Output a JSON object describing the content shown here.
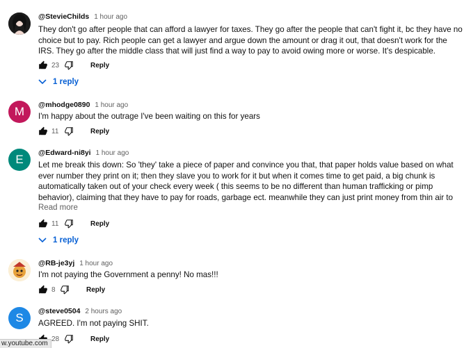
{
  "comments": [
    {
      "author": "@StevieChilds",
      "time": "1 hour ago",
      "text": "They don't go after people that can afford a lawyer for taxes. They go after the people that can't fight it, bc they have no choice but to pay. Rich people can get a lawyer and argue down the amount or drag it out, that doesn't work for the IRS. They go after the middle class that will just find a way to pay to avoid owing more or worse. It's despicable.",
      "likes": "23",
      "reply_label": "Reply",
      "replies_label": "1 reply",
      "avatar_color": "#2a2a2a"
    },
    {
      "author": "@mhodge0890",
      "time": "1 hour ago",
      "text": "I'm happy about the outrage I've been waiting on this for years",
      "likes": "11",
      "reply_label": "Reply",
      "avatar_letter": "M",
      "avatar_color": "#c2185b"
    },
    {
      "author": "@Edward-ni8yi",
      "time": "1 hour ago",
      "text": "Let me break this down: So 'they' take a piece of paper and convince you that, that paper holds value based on what ever number they print on it; then they slave you to work for it but when it comes time to get paid, a big chunk is automatically taken out of your check every week ( this seems to be no different than human trafficking or pimp behavior), claiming that they have to pay for roads, garbage ect. meanwhile they can just print money from thin air to pay for all of that themselves while still slaving and collecting money from ...",
      "read_more": "Read more",
      "likes": "11",
      "reply_label": "Reply",
      "replies_label": "1 reply",
      "avatar_letter": "E",
      "avatar_color": "#00897b"
    },
    {
      "author": "@RB-je3yj",
      "time": "1 hour ago",
      "text": "I'm not paying the Government a penny! No mas!!!",
      "likes": "8",
      "reply_label": "Reply",
      "avatar_color": "#f5deb3"
    },
    {
      "author": "@steve0504",
      "time": "2 hours ago",
      "text": "AGREED. I'm not paying SHIT.",
      "likes": "28",
      "reply_label": "Reply",
      "avatar_letter": "S",
      "avatar_color": "#1e88e5"
    }
  ],
  "status_bar": {
    "url": "w.youtube.com"
  }
}
